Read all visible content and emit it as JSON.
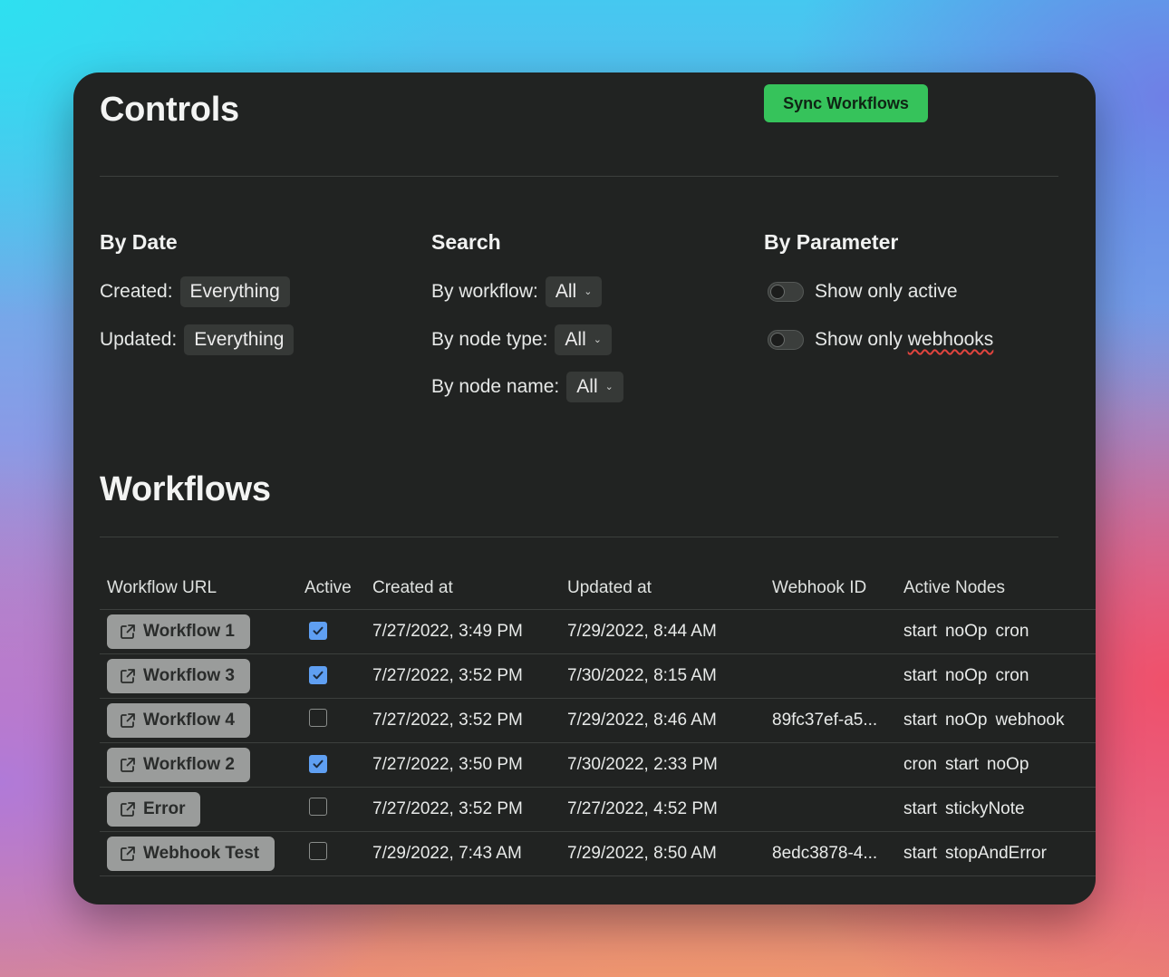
{
  "controls": {
    "title": "Controls",
    "sync_label": "Sync Workflows",
    "sync_color": "#36c35b"
  },
  "by_date": {
    "title": "By Date",
    "created_label": "Created:",
    "created_value": "Everything",
    "updated_label": "Updated:",
    "updated_value": "Everything"
  },
  "search": {
    "title": "Search",
    "workflow_label": "By workflow:",
    "workflow_value": "All",
    "node_type_label": "By node type:",
    "node_type_value": "All",
    "node_name_label": "By node name:",
    "node_name_value": "All"
  },
  "by_parameter": {
    "title": "By Parameter",
    "active_label": "Show only active",
    "active_on": false,
    "webhooks_label_prefix": "Show only ",
    "webhooks_label_word": "webhooks",
    "webhooks_on": false
  },
  "workflows": {
    "title": "Workflows",
    "columns": [
      "Workflow URL",
      "Active",
      "Created at",
      "Updated at",
      "Webhook ID",
      "Active Nodes"
    ],
    "rows": [
      {
        "name": "Workflow 1",
        "active": true,
        "created": "7/27/2022, 3:49 PM",
        "updated": "7/29/2022, 8:44 AM",
        "webhook": "",
        "nodes": [
          "start",
          "noOp",
          "cron"
        ]
      },
      {
        "name": "Workflow 3",
        "active": true,
        "created": "7/27/2022, 3:52 PM",
        "updated": "7/30/2022, 8:15 AM",
        "webhook": "",
        "nodes": [
          "start",
          "noOp",
          "cron"
        ]
      },
      {
        "name": "Workflow 4",
        "active": false,
        "created": "7/27/2022, 3:52 PM",
        "updated": "7/29/2022, 8:46 AM",
        "webhook": "89fc37ef-a5...",
        "nodes": [
          "start",
          "noOp",
          "webhook"
        ]
      },
      {
        "name": "Workflow 2",
        "active": true,
        "created": "7/27/2022, 3:50 PM",
        "updated": "7/30/2022, 2:33 PM",
        "webhook": "",
        "nodes": [
          "cron",
          "start",
          "noOp"
        ]
      },
      {
        "name": "Error",
        "active": false,
        "created": "7/27/2022, 3:52 PM",
        "updated": "7/27/2022, 4:52 PM",
        "webhook": "",
        "nodes": [
          "start",
          "stickyNote"
        ]
      },
      {
        "name": "Webhook Test",
        "active": false,
        "created": "7/29/2022, 7:43 AM",
        "updated": "7/29/2022, 8:50 AM",
        "webhook": "8edc3878-4...",
        "nodes": [
          "start",
          "stopAndError"
        ]
      }
    ]
  },
  "icons": {
    "link": "external-link-icon",
    "check": "checkmark-icon",
    "chevron": "chevron-down-icon"
  }
}
